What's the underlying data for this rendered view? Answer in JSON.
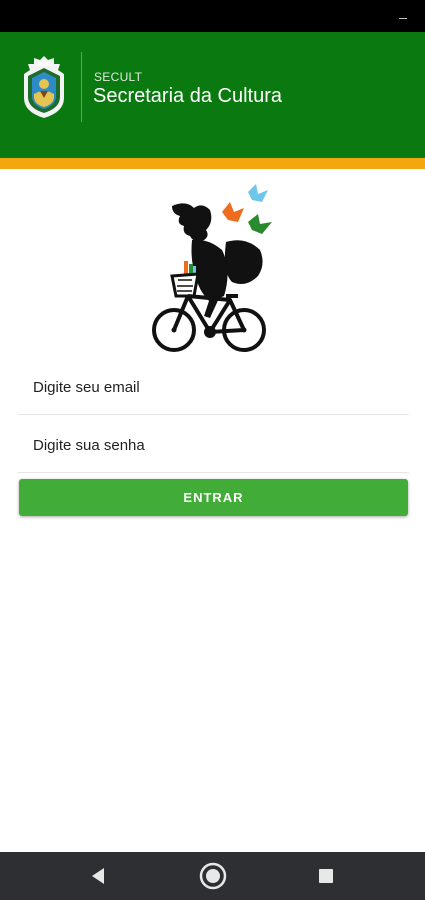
{
  "header": {
    "brand_small": "SECULT",
    "brand_title": "Secretaria da Cultura"
  },
  "login": {
    "email_placeholder": "Digite seu email",
    "password_placeholder": "Digite sua senha",
    "submit_label": "ENTRAR"
  },
  "icons": {
    "crest": "state-coat-of-arms-icon",
    "logo": "girl-on-bicycle-with-butterflies-logo",
    "back": "nav-back-icon",
    "home": "nav-home-icon",
    "recent": "nav-recent-apps-icon"
  },
  "colors": {
    "header_green": "#0a7a10",
    "stripe_orange": "#f2a70f",
    "button_green": "#41ad38",
    "nav_bar": "#2d2f33"
  }
}
